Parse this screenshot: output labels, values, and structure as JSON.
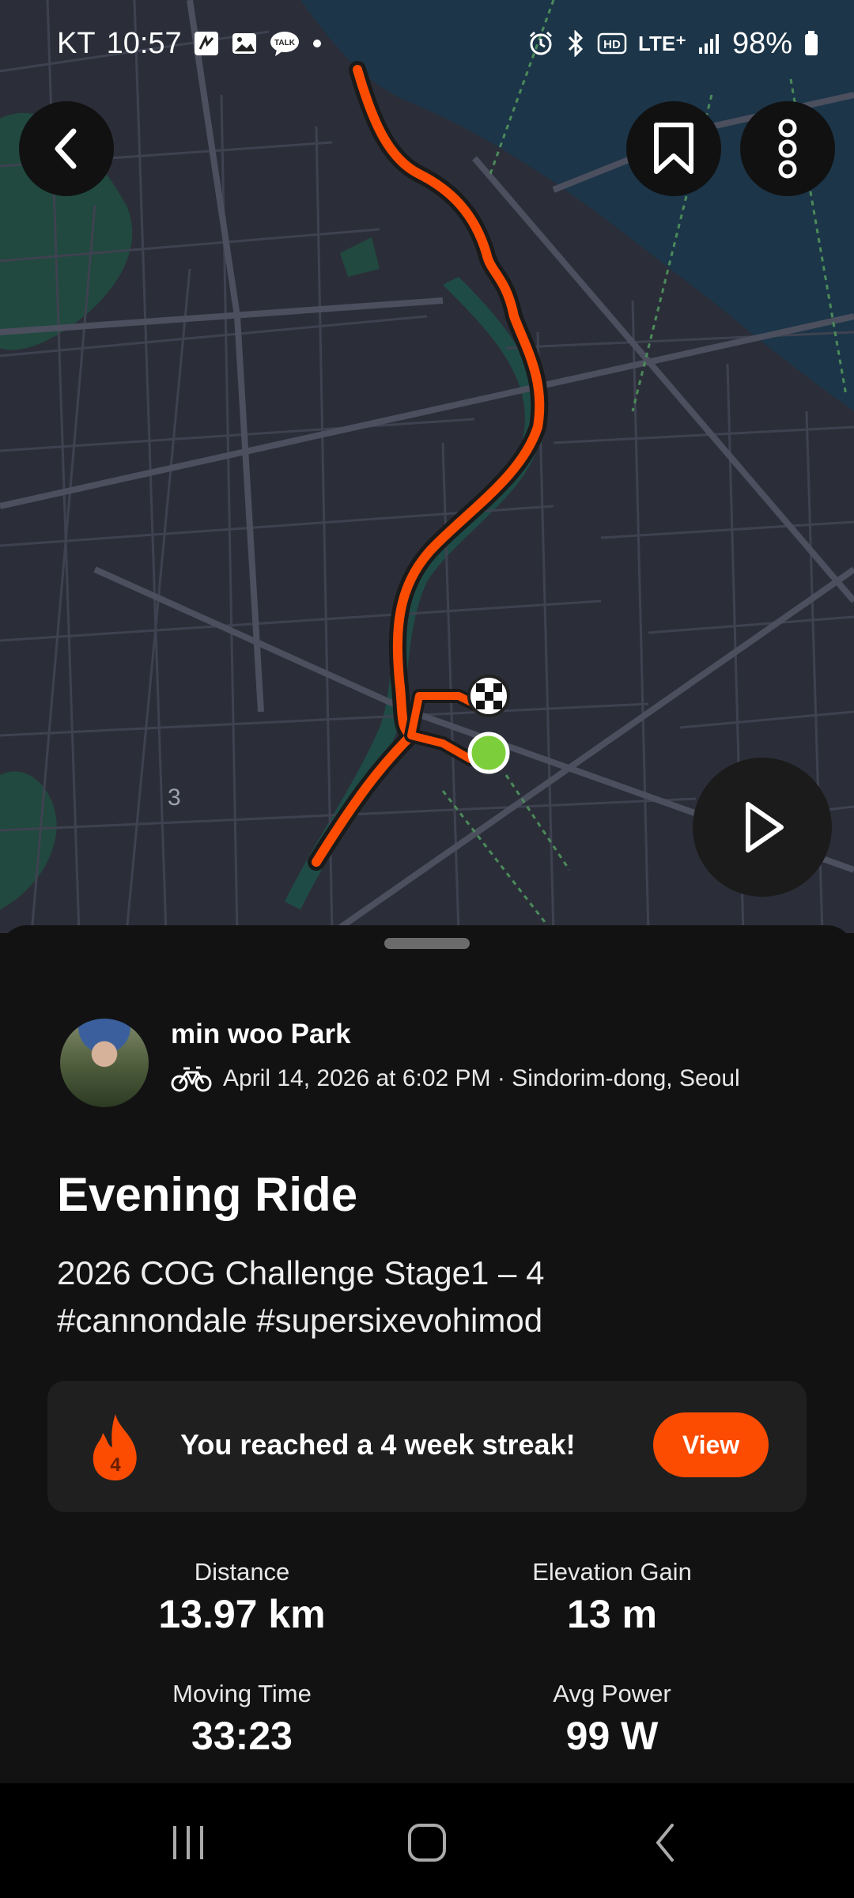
{
  "status_bar": {
    "carrier": "KT",
    "time": "10:57",
    "lte": "LTE⁺",
    "battery": "98%",
    "icons": [
      "nfc-icon",
      "gallery-icon",
      "talk-icon",
      "dot-icon",
      "alarm-icon",
      "bluetooth-icon",
      "hd-icon",
      "signal-icon",
      "battery-icon"
    ]
  },
  "map": {
    "route_color": "#fc4c02",
    "start_marker_color": "#7ccf3a",
    "map_label": "3"
  },
  "activity": {
    "athlete_name": "min woo Park",
    "sport_icon": "bike-icon",
    "meta": "April 14, 2026 at 6:02 PM · Sindorim-dong, Seoul",
    "title": "Evening Ride",
    "description_line1": "2026  COG Challenge Stage1 – 4",
    "description_line2": "#cannondale  #supersixevohimod"
  },
  "streak": {
    "weeks": "4",
    "text": "You reached a 4 week streak!",
    "button": "View",
    "accent": "#fc4c02"
  },
  "stats": [
    {
      "label": "Distance",
      "value": "13.97 km"
    },
    {
      "label": "Elevation Gain",
      "value": "13 m"
    },
    {
      "label": "Moving Time",
      "value": "33:23"
    },
    {
      "label": "Avg Power",
      "value": "99 W"
    }
  ]
}
